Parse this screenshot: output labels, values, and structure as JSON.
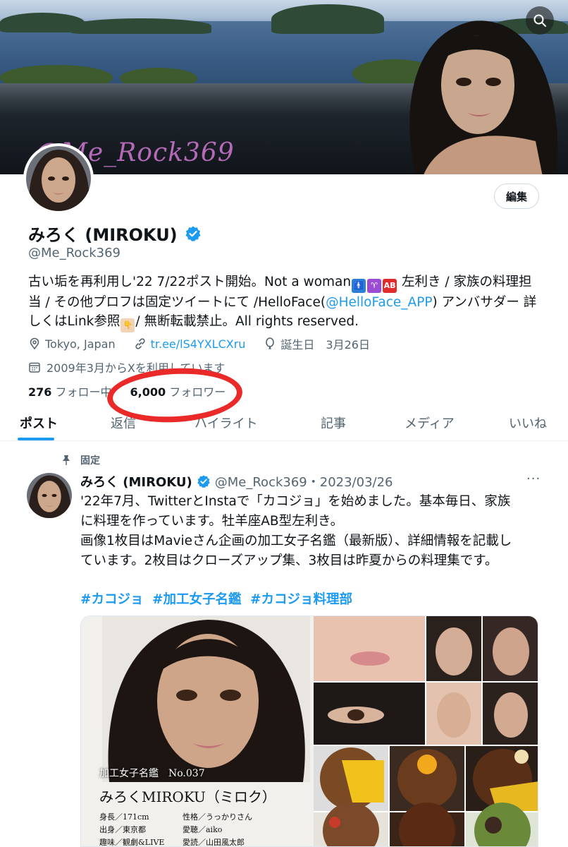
{
  "banner": {
    "watermark": "@Me_Rock369"
  },
  "toolbar": {
    "edit_label": "編集"
  },
  "profile": {
    "name": "みろく (MIROKU)",
    "handle": "@Me_Rock369",
    "bio": {
      "line1_pre": "古い垢を再利用し'22 7/22ポスト開始。Not a woman",
      "ab": "AB",
      "line1_post": " 左利き / 家族の料理担当 / その他プロフは固定ツイートにて /HelloFace(",
      "mention": "@HelloFace_APP",
      "line2_post": ") アンバサダー 詳しくはLink参照",
      "line3": "/ 無断転載禁止。All rights reserved."
    },
    "location": "Tokyo, Japan",
    "website": "tr.ee/lS4YXLCXru",
    "birthday": "誕生日　3月26日",
    "joined": "2009年3月からXを利用しています",
    "following_count": "276",
    "following_label": "フォロー中",
    "followers_count": "6,000",
    "followers_label": "フォロワー"
  },
  "tabs": [
    "ポスト",
    "返信",
    "ハイライト",
    "記事",
    "メディア",
    "いいね"
  ],
  "tweet": {
    "pinned_label": "固定",
    "name": "みろく (MIROKU)",
    "handle_date": "@Me_Rock369・2023/03/26",
    "more": "···",
    "body_line1": "'22年7月、TwitterとInstaで「カコジョ」を始めました。基本毎日、家族",
    "body_line2": "に料理を作っています。牡羊座AB型左利き。",
    "body_line3": "画像1枚目はMavieさん企画の加工女子名鑑（最新版）、詳細情報を記載し",
    "body_line4": "ています。2枚目はクローズアップ集、3枚目は昨夏からの料理集です。",
    "hashtags": [
      "#カコジョ",
      "#加工女子名鑑",
      "#カコジョ料理部"
    ]
  },
  "card": {
    "label": "加工女子名鑑　No.037",
    "name": "みろくMIROKU（ミロク）",
    "attrs": [
      "身長／171cm",
      "性格／うっかりさん",
      "出身／東京都",
      "愛聴／aiko",
      "趣味／観劇&LIVE",
      "愛読／山田風太郎"
    ]
  },
  "colors": {
    "accent": "#1d9bf0",
    "annotation": "#ea2a28"
  }
}
